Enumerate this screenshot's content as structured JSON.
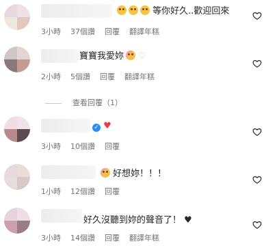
{
  "comments": [
    {
      "text": "等你好久..歡迎回來",
      "emoji_count": 3,
      "time": "3小時",
      "likes": "37個讚",
      "reply": "回覆",
      "translate": "翻譯年糕"
    },
    {
      "text": "寶寶我愛妳",
      "time": "2小時",
      "likes": "5個讚",
      "reply": "回覆",
      "translate": "翻譯年糕"
    },
    {
      "text": "",
      "time": "3小時",
      "likes": "10個讚",
      "reply": "回覆",
      "translate": ""
    },
    {
      "text": "好想妳！！！",
      "time": "1小時",
      "likes": "12個讚",
      "reply": "回覆",
      "translate": ""
    },
    {
      "text": "好久沒聽到妳的聲音了！",
      "time": "3小時",
      "likes": "14個讚",
      "reply": "回覆",
      "translate": "翻譯年糕"
    }
  ],
  "view_replies": "查看回覆（1）",
  "colors": {
    "accent_red": "#ed3b46",
    "verified_blue": "#2b8ef7",
    "meta_gray": "#737373"
  }
}
